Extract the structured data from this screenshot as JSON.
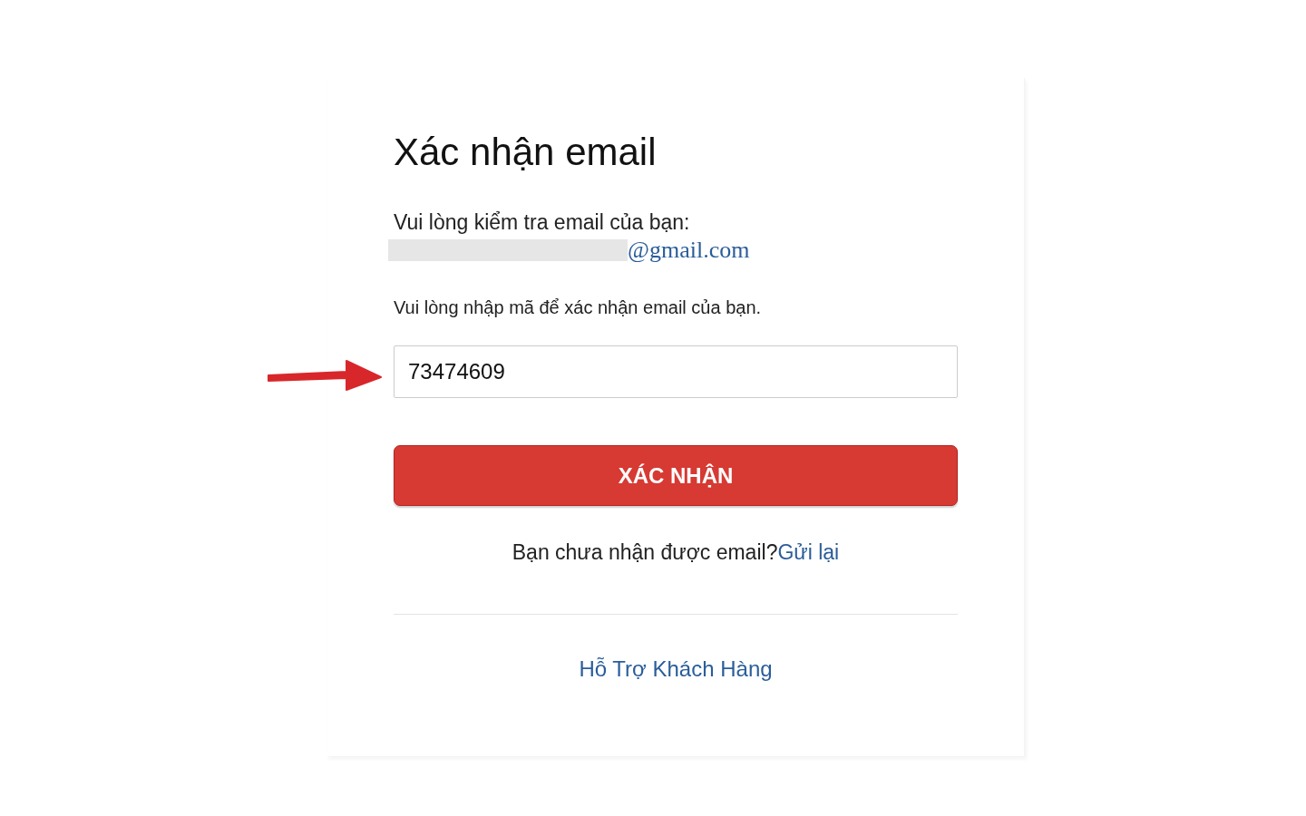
{
  "title": "Xác nhận email",
  "check_text": "Vui lòng kiểm tra email của bạn:",
  "email": {
    "domain": "@gmail.com"
  },
  "instruction": "Vui lòng nhập mã để xác nhận email của bạn.",
  "code_field": {
    "value": "73474609"
  },
  "confirm_button": "XÁC NHẬN",
  "resend": {
    "text": "Bạn chưa nhận được email?",
    "link": "Gửi lại"
  },
  "support_link": "Hỗ Trợ Khách Hàng"
}
